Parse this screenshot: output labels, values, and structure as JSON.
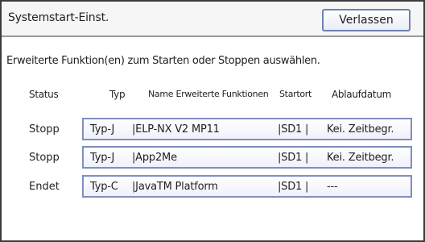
{
  "header": {
    "title": "Systemstart-Einst.",
    "exit_label": "Verlassen"
  },
  "instruction": "Erweiterte Funktion(en) zum Starten oder Stoppen auswählen.",
  "columns": {
    "status": "Status",
    "type": "Typ",
    "name": "Name Erweiterte Funktionen",
    "start": "Startort",
    "expire": "Ablaufdatum"
  },
  "rows": [
    {
      "status": "Stopp",
      "type": "Typ-J",
      "name": "|ELP-NX V2 MP11",
      "start": "|SD1 |",
      "expire": "Kei. Zeitbegr."
    },
    {
      "status": "Stopp",
      "type": "Typ-J",
      "name": "|App2Me",
      "start": "|SD1 |",
      "expire": "Kei. Zeitbegr."
    },
    {
      "status": "Endet",
      "type": "Typ-C",
      "name": "|JavaTM Platform",
      "start": "|SD1 |",
      "expire": "---"
    }
  ]
}
